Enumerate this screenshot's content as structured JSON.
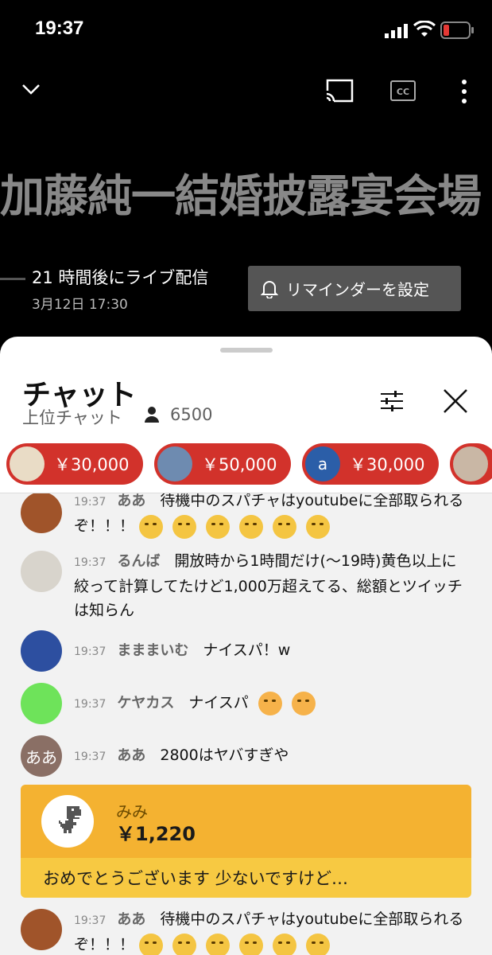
{
  "status_bar": {
    "time": "19:37"
  },
  "video": {
    "title": "加藤純一結婚披露宴会場",
    "live_text": "21 時間後にライブ配信",
    "date": "3月12日 17:30",
    "reminder_label": "リマインダーを設定"
  },
  "chat": {
    "title": "チャット",
    "mode": "上位チャット",
    "viewer_count": "6500",
    "tickers": [
      {
        "amount": "￥30,000",
        "avatar_color": "#e9dcc6"
      },
      {
        "amount": "￥50,000",
        "avatar_color": "#6e8bb0"
      },
      {
        "amount": "￥30,000",
        "avatar_color": "#2b5ea8",
        "avatar_letter": "a"
      },
      {
        "amount": "",
        "avatar_color": "#c9b7a5"
      }
    ],
    "messages": [
      {
        "time": "19:37",
        "author": "ああ",
        "text": "待機中のスパチャはyoutubeに全部取られるぞ！！！"
      },
      {
        "time": "19:37",
        "author": "るんば",
        "text": "開放時から1時間だけ(〜19時)黄色以上に絞って計算してたけど1,000万超えてる、総額とツイッチは知らん"
      },
      {
        "time": "19:37",
        "author": "まままいむ",
        "text": "ナイスパ！w"
      },
      {
        "time": "19:37",
        "author": "ケヤカス",
        "text": "ナイスパ"
      },
      {
        "time": "19:37",
        "author": "ああ",
        "text": "2800はヤバすぎや",
        "avatar_text": "ああ"
      },
      {
        "time": "19:37",
        "author": "ああ",
        "text": "待機中のスパチャはyoutubeに全部取られるぞ！！！"
      }
    ],
    "superchat": {
      "name": "みみ",
      "amount": "￥1,220",
      "message": "おめでとうございます 少ないですけど…"
    }
  },
  "colors": {
    "ticker_red": "#d2322b",
    "superchat_top": "#f4b231",
    "superchat_bottom": "#f7c942",
    "green_avatar": "#6ee35a",
    "brown_avatar": "#8a6f65"
  }
}
